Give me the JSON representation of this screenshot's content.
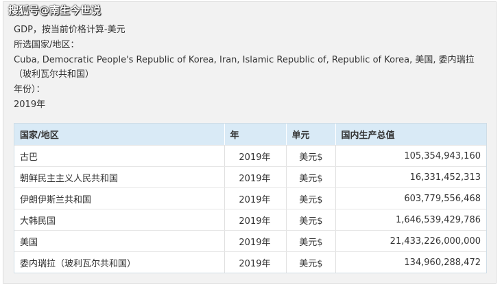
{
  "watermark": "搜狐号@南生今世说",
  "info": {
    "indicator": "GDP，按当前价格计算-美元",
    "country_label": "所选国家/地区：",
    "countries": "Cuba, Democratic People's Republic of Korea, Iran, Islamic Republic of, Republic of Korea, 美国, 委内瑞拉",
    "countries_cont": "（玻利瓦尔共和国）",
    "year_label": "年份）：",
    "year_value": "2019年"
  },
  "table": {
    "headers": [
      "国家/地区",
      "年",
      "单元",
      "国内生产总值"
    ],
    "rows": [
      {
        "country": "古巴",
        "year": "2019年",
        "unit": "美元$",
        "value": "105,354,943,160"
      },
      {
        "country": "朝鲜民主主义人民共和国",
        "year": "2019年",
        "unit": "美元$",
        "value": "16,331,452,313"
      },
      {
        "country": "伊朗伊斯兰共和国",
        "year": "2019年",
        "unit": "美元$",
        "value": "603,779,556,468"
      },
      {
        "country": "大韩民国",
        "year": "2019年",
        "unit": "美元$",
        "value": "1,646,539,429,786"
      },
      {
        "country": "美国",
        "year": "2019年",
        "unit": "美元$",
        "value": "21,433,226,000,000"
      },
      {
        "country": "委内瑞拉（玻利瓦尔共和国）",
        "year": "2019年",
        "unit": "美元$",
        "value": "134,960,288,472"
      }
    ]
  }
}
